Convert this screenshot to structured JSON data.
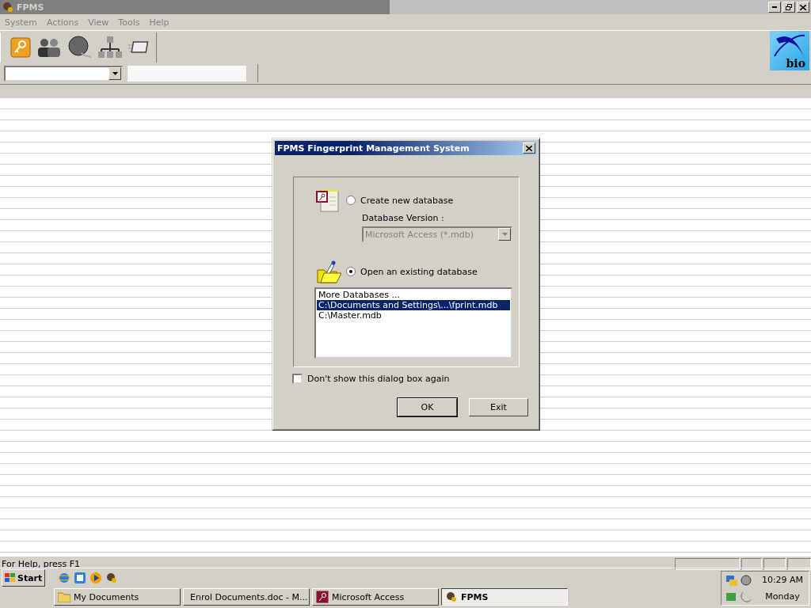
{
  "window": {
    "title": "FPMS",
    "active": false
  },
  "menu": [
    "System",
    "Actions",
    "View",
    "Tools",
    "Help"
  ],
  "logo_text": "bio",
  "dialog": {
    "title": "FPMS Fingerprint Management System",
    "options": [
      {
        "label": "Create new database",
        "selected": false
      },
      {
        "label": "Open an existing database",
        "selected": true
      }
    ],
    "version": {
      "label": "Database Version :",
      "value": "Microsoft Access (*.mdb)",
      "disabled": true
    },
    "databases": [
      {
        "label": "More Databases ...",
        "selected": false
      },
      {
        "label": "C:\\Documents and Settings\\...\\fprint.mdb",
        "selected": true
      },
      {
        "label": "C:\\Master.mdb",
        "selected": false
      }
    ],
    "dont_show": {
      "label": "Don't show this dialog box again",
      "checked": false
    },
    "buttons": [
      "OK",
      "Exit"
    ]
  },
  "status_bar": "For Help, press F1",
  "taskbar": {
    "start": "Start",
    "tasks": [
      {
        "label": "My Documents",
        "selected": false
      },
      {
        "label": "Enrol Documents.doc - M...",
        "selected": false
      },
      {
        "label": "Microsoft Access",
        "selected": false
      },
      {
        "label": "FPMS",
        "selected": true
      }
    ],
    "time": "10:29 AM",
    "day": "Monday"
  }
}
